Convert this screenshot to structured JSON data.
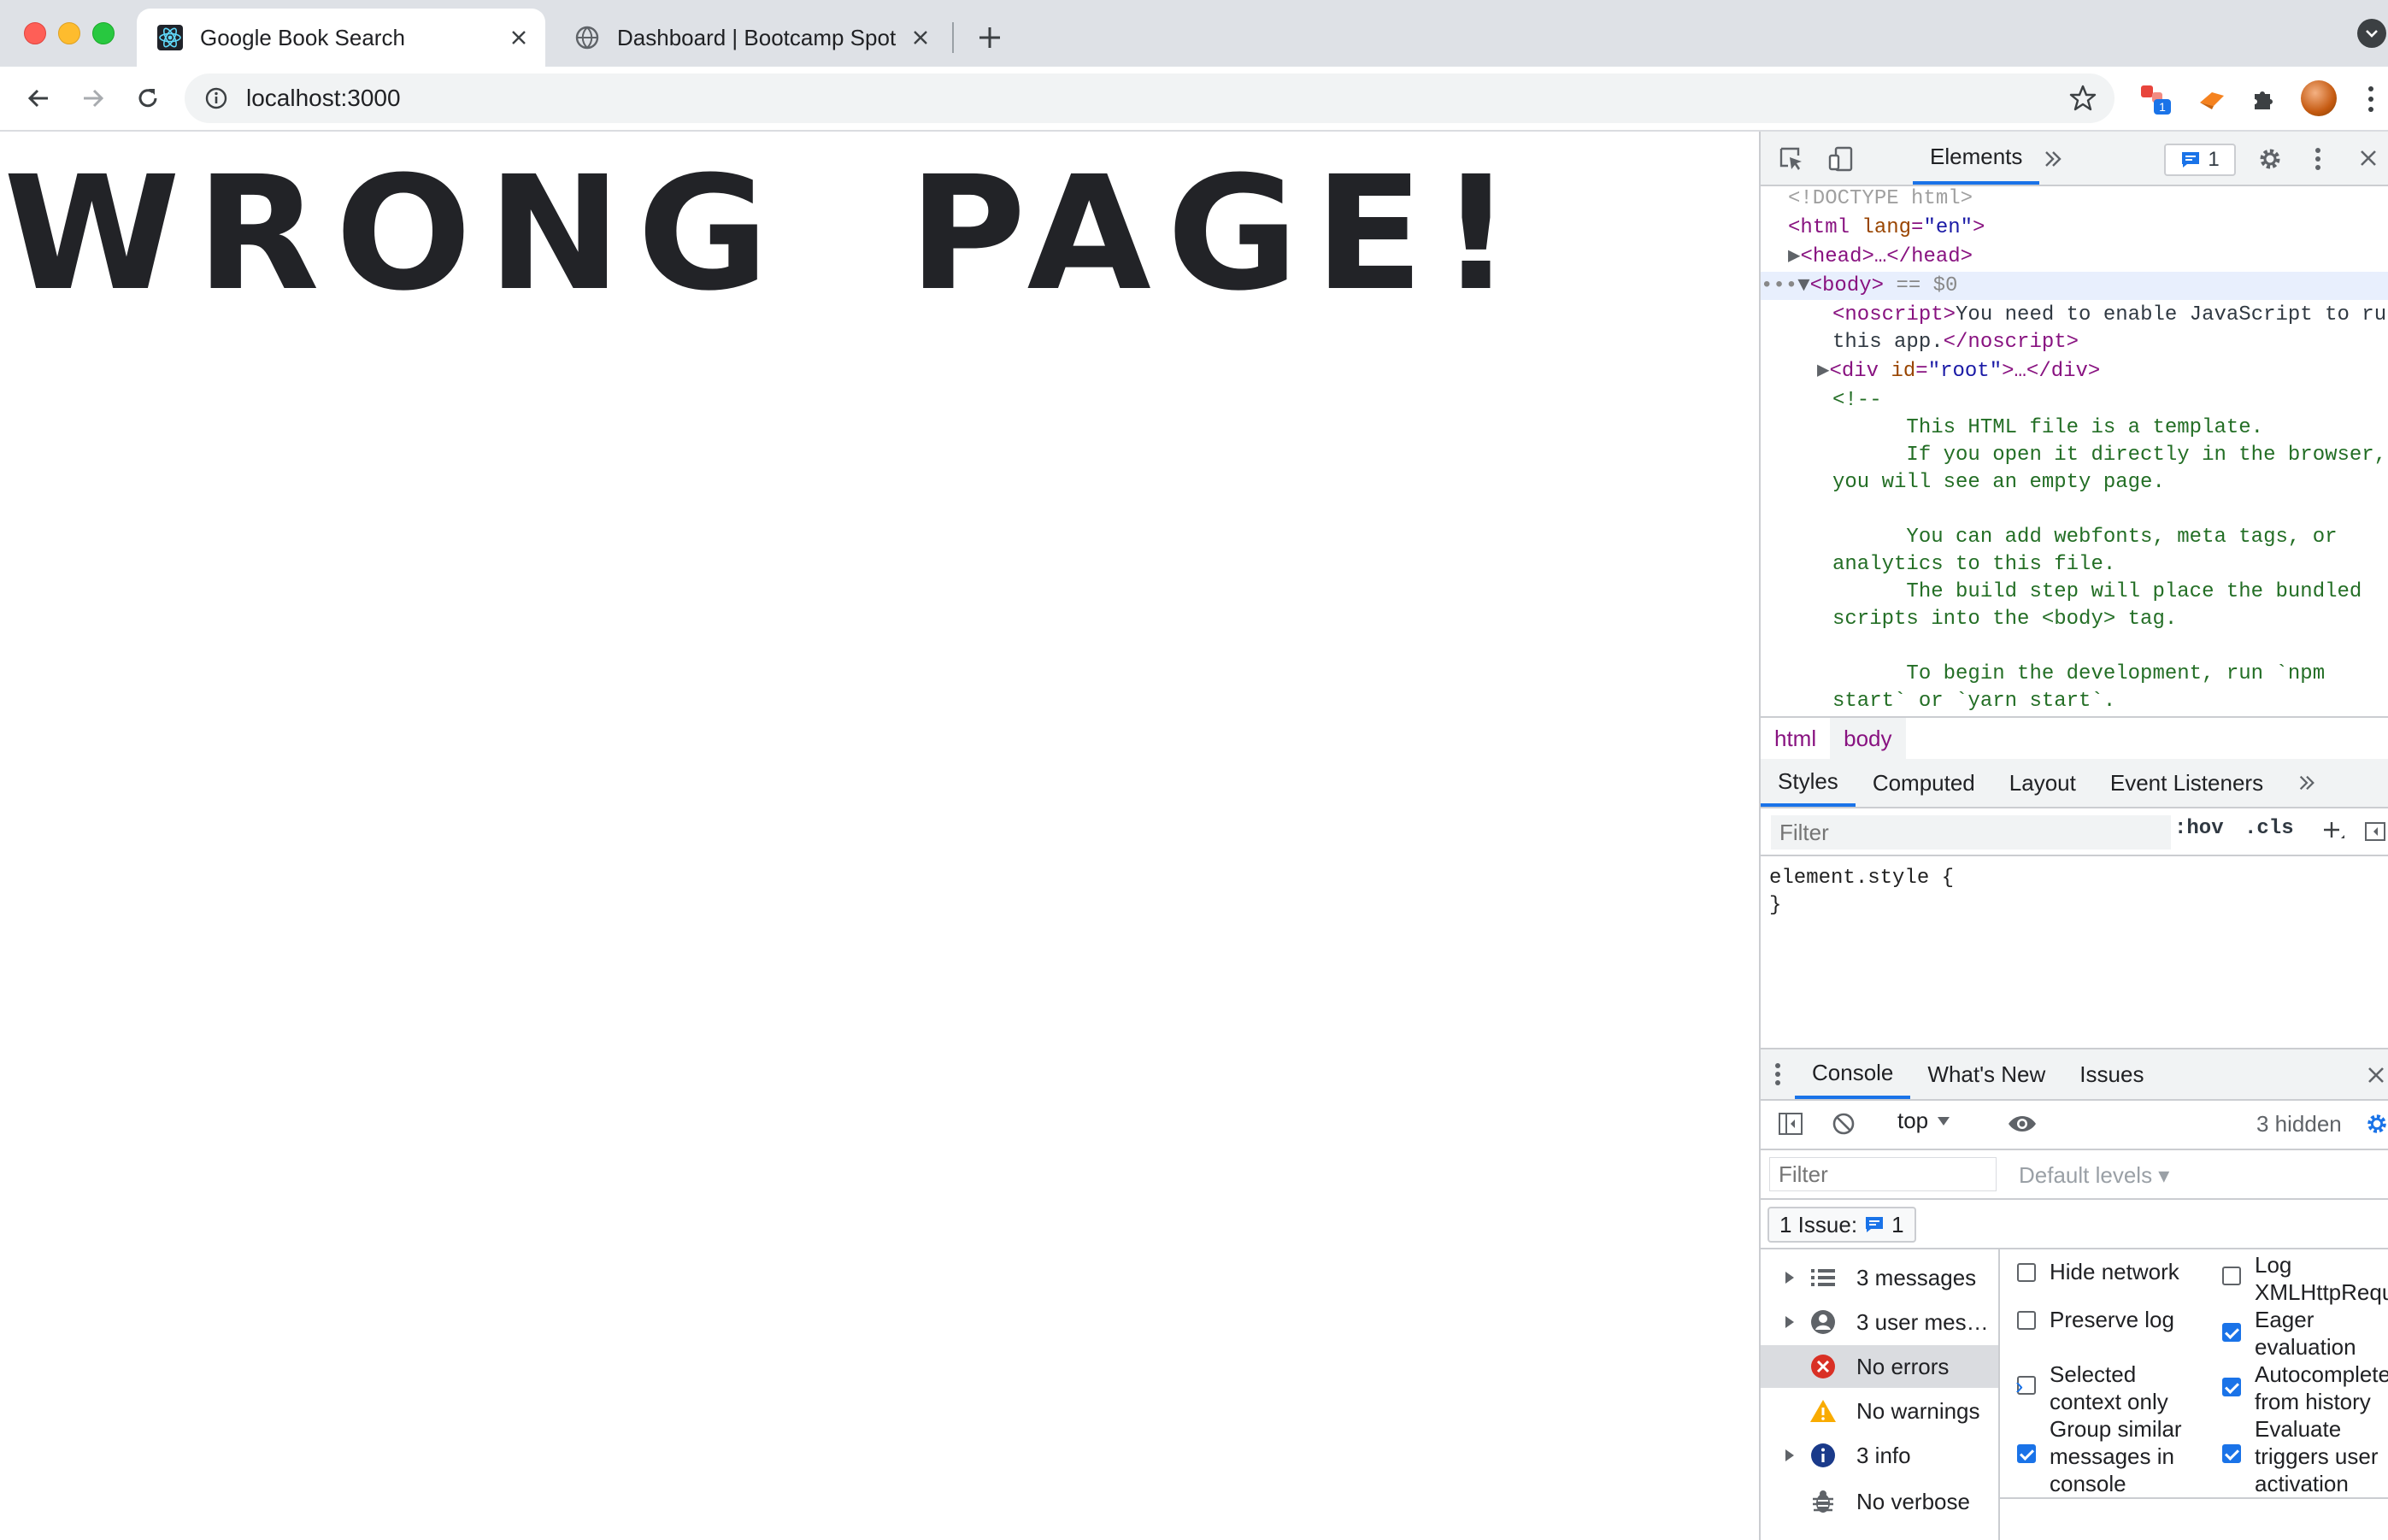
{
  "browser": {
    "tabs": [
      {
        "title": "Google Book Search",
        "active": true,
        "favicon": "react-icon"
      },
      {
        "title": "Dashboard | Bootcamp Spot",
        "active": false,
        "favicon": "globe-icon"
      }
    ],
    "new_tab_glyph": "+",
    "url": "localhost:3000",
    "extension_badge": "1"
  },
  "page": {
    "heading": "WRONG PAGE!"
  },
  "devtools": {
    "main_tab": "Elements",
    "issues_count": "1",
    "dom": {
      "doctype": "<!DOCTYPE html>",
      "html_open_tag": "html",
      "html_attr": "lang",
      "html_attr_val": "\"en\"",
      "head_collapsed": "<head>…</head>",
      "body_tag": "<body>",
      "body_suffix": " == $0",
      "noscript_text_1": "You need to enable JavaScript to ru",
      "noscript_text_2": "this app.",
      "div_attr": "id",
      "div_attr_val": "\"root\"",
      "comment_lines": [
        "<!--",
        "      This HTML file is a template.",
        "      If you open it directly in the browser,",
        "you will see an empty page.",
        "",
        "      You can add webfonts, meta tags, or",
        "analytics to this file.",
        "      The build step will place the bundled",
        "scripts into the <body> tag.",
        "",
        "      To begin the development, run `npm",
        "start` or `yarn start`."
      ]
    },
    "breadcrumbs": [
      "html",
      "body"
    ],
    "styles_tabs": [
      "Styles",
      "Computed",
      "Layout",
      "Event Listeners"
    ],
    "styles_filter_placeholder": "Filter",
    "hov": ":hov",
    "cls": ".cls",
    "element_style": "element.style {\n}",
    "drawer_tabs": [
      "Console",
      "What's New",
      "Issues"
    ],
    "console": {
      "context": "top",
      "hidden": "3 hidden",
      "filter_placeholder": "Filter",
      "levels": "Default levels",
      "issue_label": "1 Issue:",
      "issue_count": "1",
      "sidebar": [
        {
          "label": "3 messages",
          "icon": "list-icon",
          "expandable": true
        },
        {
          "label": "3 user mes…",
          "icon": "user-icon",
          "expandable": true
        },
        {
          "label": "No errors",
          "icon": "error-icon",
          "expandable": false,
          "selected": true
        },
        {
          "label": "No warnings",
          "icon": "warning-icon",
          "expandable": false
        },
        {
          "label": "3 info",
          "icon": "info-icon",
          "expandable": true
        },
        {
          "label": "No verbose",
          "icon": "bug-icon",
          "expandable": false
        }
      ],
      "settings_left": [
        {
          "label": "Hide network",
          "checked": false
        },
        {
          "label": "Preserve log",
          "checked": false
        },
        {
          "label": "Selected\ncontext only",
          "checked": false
        },
        {
          "label": "Group similar\nmessages in\nconsole",
          "checked": true
        }
      ],
      "settings_right": [
        {
          "label": "Log\nXMLHttpRequ",
          "checked": false
        },
        {
          "label": "Eager\nevaluation",
          "checked": true
        },
        {
          "label": "Autocomplete\nfrom history",
          "checked": true
        },
        {
          "label": "Evaluate\ntriggers user\nactivation",
          "checked": true
        }
      ],
      "prompt": "›"
    }
  },
  "colors": {
    "accent": "#1a73e8",
    "tag": "#881280",
    "comment": "#236e25",
    "heading": "#222327"
  }
}
